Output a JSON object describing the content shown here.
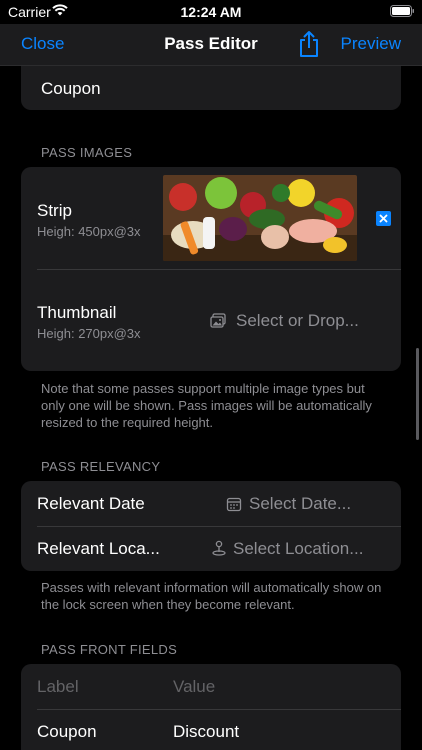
{
  "status_bar": {
    "carrier": "Carrier",
    "time": "12:24 AM"
  },
  "nav": {
    "close": "Close",
    "title": "Pass Editor",
    "preview": "Preview"
  },
  "coupon_row": {
    "label": "Coupon"
  },
  "pass_images": {
    "header": "PASS IMAGES",
    "strip": {
      "title": "Strip",
      "subtitle": "Heigh: 450px@3x"
    },
    "thumbnail": {
      "title": "Thumbnail",
      "subtitle": "Heigh: 270px@3x",
      "placeholder": "Select or Drop..."
    },
    "note": "Note that some passes support multiple image types but only one will be shown. Pass images will be automatically resized to the required height."
  },
  "pass_relevancy": {
    "header": "PASS RELEVANCY",
    "date": {
      "title": "Relevant Date",
      "placeholder": "Select Date..."
    },
    "location": {
      "title": "Relevant Loca...",
      "placeholder": "Select Location..."
    },
    "note": "Passes with relevant information will automatically show on the lock screen when they become relevant."
  },
  "pass_front_fields": {
    "header": "PASS FRONT FIELDS",
    "columns": {
      "label": "Label",
      "value": "Value"
    },
    "rows": [
      {
        "label": "Coupon",
        "value": "Discount"
      }
    ]
  },
  "colors": {
    "accent": "#0a84ff",
    "card": "#1c1c1e",
    "secondary_text": "#8e8e93"
  },
  "icons": [
    "wifi-icon",
    "battery-icon",
    "share-icon",
    "remove-image-icon",
    "photo-icon",
    "calendar-icon",
    "location-pin-icon"
  ]
}
